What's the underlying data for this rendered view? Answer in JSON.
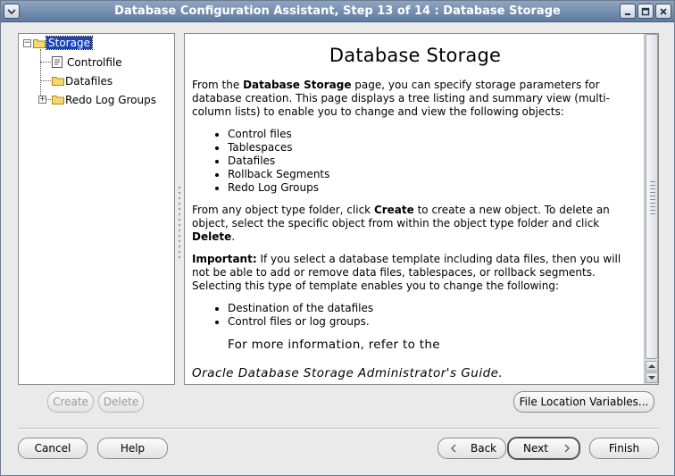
{
  "window": {
    "title": "Database Configuration Assistant, Step 13 of 14 : Database Storage"
  },
  "tree": {
    "root": "Storage",
    "children": [
      "Controlfile",
      "Datafiles",
      "Redo Log Groups"
    ]
  },
  "help": {
    "heading": "Database Storage",
    "intro_pre": "From the ",
    "intro_bold": "Database Storage",
    "intro_post": " page, you can specify storage parameters for database creation. This page displays a tree listing and summary view (multi-column lists) to enable you to change and view the following objects:",
    "objects": [
      "Control files",
      "Tablespaces",
      "Datafiles",
      "Rollback Segments",
      "Redo Log Groups"
    ],
    "create_pre": "From any object type folder, click ",
    "create_bold": "Create",
    "create_mid": " to create a new object. To delete an object, select the specific object from within the object type folder and click ",
    "delete_bold": "Delete",
    "create_end": ".",
    "important_label": "Important:",
    "important_text": " If you select a database template including data files, then you will not be able to add or remove data files, tablespaces, or rollback segments. Selecting this type of template enables you to change the following:",
    "template_items": [
      "Destination of the datafiles",
      "Control files or log groups."
    ],
    "more_info": "For more information, refer to the",
    "guide": "Oracle Database Storage Administrator's Guide."
  },
  "buttons": {
    "create": "Create",
    "delete": "Delete",
    "file_location": "File Location Variables...",
    "cancel": "Cancel",
    "help": "Help",
    "back": "Back",
    "next": "Next",
    "finish": "Finish"
  }
}
